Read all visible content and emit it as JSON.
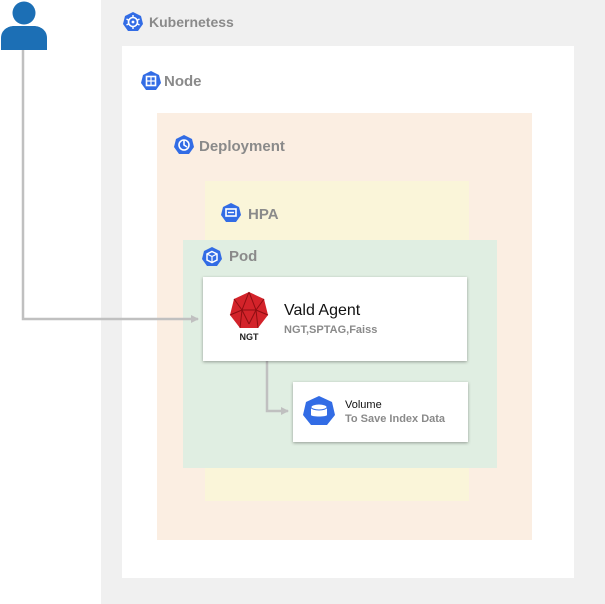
{
  "containers": {
    "kubernetes": {
      "label": "Kubernetess",
      "bg": "#f0f0f0"
    },
    "node": {
      "label": "Node",
      "bg": "#ffffff"
    },
    "deployment": {
      "label": "Deployment",
      "bg": "#fbeee2"
    },
    "hpa": {
      "label": "HPA",
      "bg": "#faf5d9"
    },
    "pod": {
      "label": "Pod",
      "bg": "#e0eee2"
    }
  },
  "agent": {
    "title": "Vald Agent",
    "subtitle": "NGT,SPTAG,Faiss",
    "logo_text": "NGT"
  },
  "volume": {
    "title": "Volume",
    "subtitle": "To Save Index Data"
  },
  "colors": {
    "user": "#1c6fb5",
    "k8s_blue": "#326ce5",
    "ngt_red": "#d3232a",
    "arrow": "#c0c0c0",
    "label_gray": "#8a8a8a"
  },
  "icons": {
    "user": "user-icon",
    "kubernetes": "kubernetes-icon",
    "node": "node-icon",
    "deployment": "deployment-icon",
    "hpa": "hpa-icon",
    "pod": "pod-icon",
    "volume": "volume-icon",
    "ngt": "ngt-logo"
  }
}
